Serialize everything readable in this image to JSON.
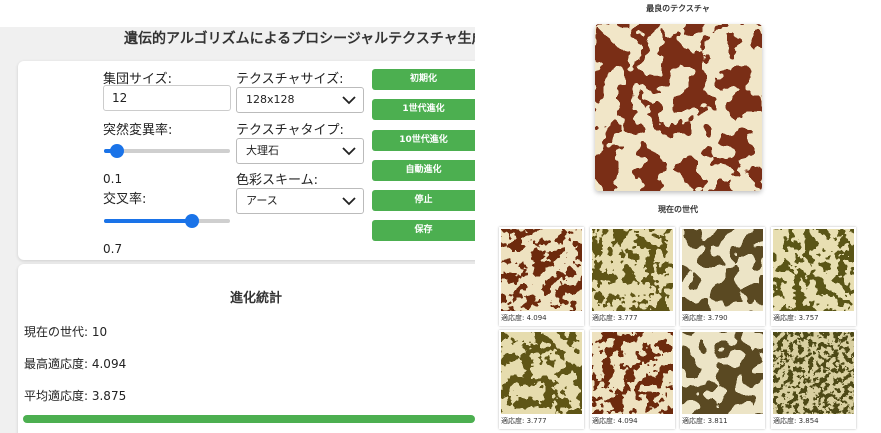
{
  "app": {
    "title": "遺伝的アルゴリズムによるプロシージャルテクスチャ生成"
  },
  "controls": {
    "population": {
      "label": "集団サイズ:",
      "value": "12"
    },
    "texture_size": {
      "label": "テクスチャサイズ:",
      "selected": "128x128"
    },
    "mutation": {
      "label": "突然変異率:",
      "value": 0.1,
      "display": "0.1",
      "min": 0,
      "max": 1
    },
    "texture_type": {
      "label": "テクスチャタイプ:",
      "selected": "大理石"
    },
    "crossover": {
      "label": "交叉率:",
      "value": 0.7,
      "display": "0.7",
      "min": 0,
      "max": 1
    },
    "color_scheme": {
      "label": "色彩スキーム:",
      "selected": "アース"
    },
    "buttons": {
      "init": "初期化",
      "step1": "1世代進化",
      "step10": "10世代進化",
      "auto": "自動進化",
      "stop": "停止",
      "save": "保存"
    },
    "button_color": "#4caf50"
  },
  "stats": {
    "title": "進化統計",
    "generation_text": "現在の世代: 10",
    "best_text": "最高適応度: 4.094",
    "avg_text": "平均適応度: 3.875",
    "progress": 1.0
  },
  "best": {
    "title": "最良のテクスチャ",
    "palette": [
      "#f1e6c8",
      "#7a2e12"
    ]
  },
  "current": {
    "title": "現在の世代",
    "cells": [
      {
        "fitness": "適応度: 4.094",
        "palette": [
          "#eee2c0",
          "#6d2a10"
        ],
        "style": "mottled"
      },
      {
        "fitness": "適応度: 3.777",
        "palette": [
          "#e6dcae",
          "#5e5418"
        ],
        "style": "mottled"
      },
      {
        "fitness": "適応度: 3.790",
        "palette": [
          "#ece4c6",
          "#5a4a22"
        ],
        "style": "blob"
      },
      {
        "fitness": "適応度: 3.757",
        "palette": [
          "#e8dfb2",
          "#5a5518"
        ],
        "style": "mottled"
      },
      {
        "fitness": "適応度: 3.777",
        "palette": [
          "#e6dcae",
          "#5e5418"
        ],
        "style": "mottled"
      },
      {
        "fitness": "適応度: 4.094",
        "palette": [
          "#eee2c0",
          "#6d2a10"
        ],
        "style": "mottled"
      },
      {
        "fitness": "適応度: 3.811",
        "palette": [
          "#ece4c6",
          "#5a4a22"
        ],
        "style": "blob"
      },
      {
        "fitness": "適応度: 3.854",
        "palette": [
          "#d8cfa0",
          "#4e4818"
        ],
        "style": "fine"
      }
    ]
  }
}
